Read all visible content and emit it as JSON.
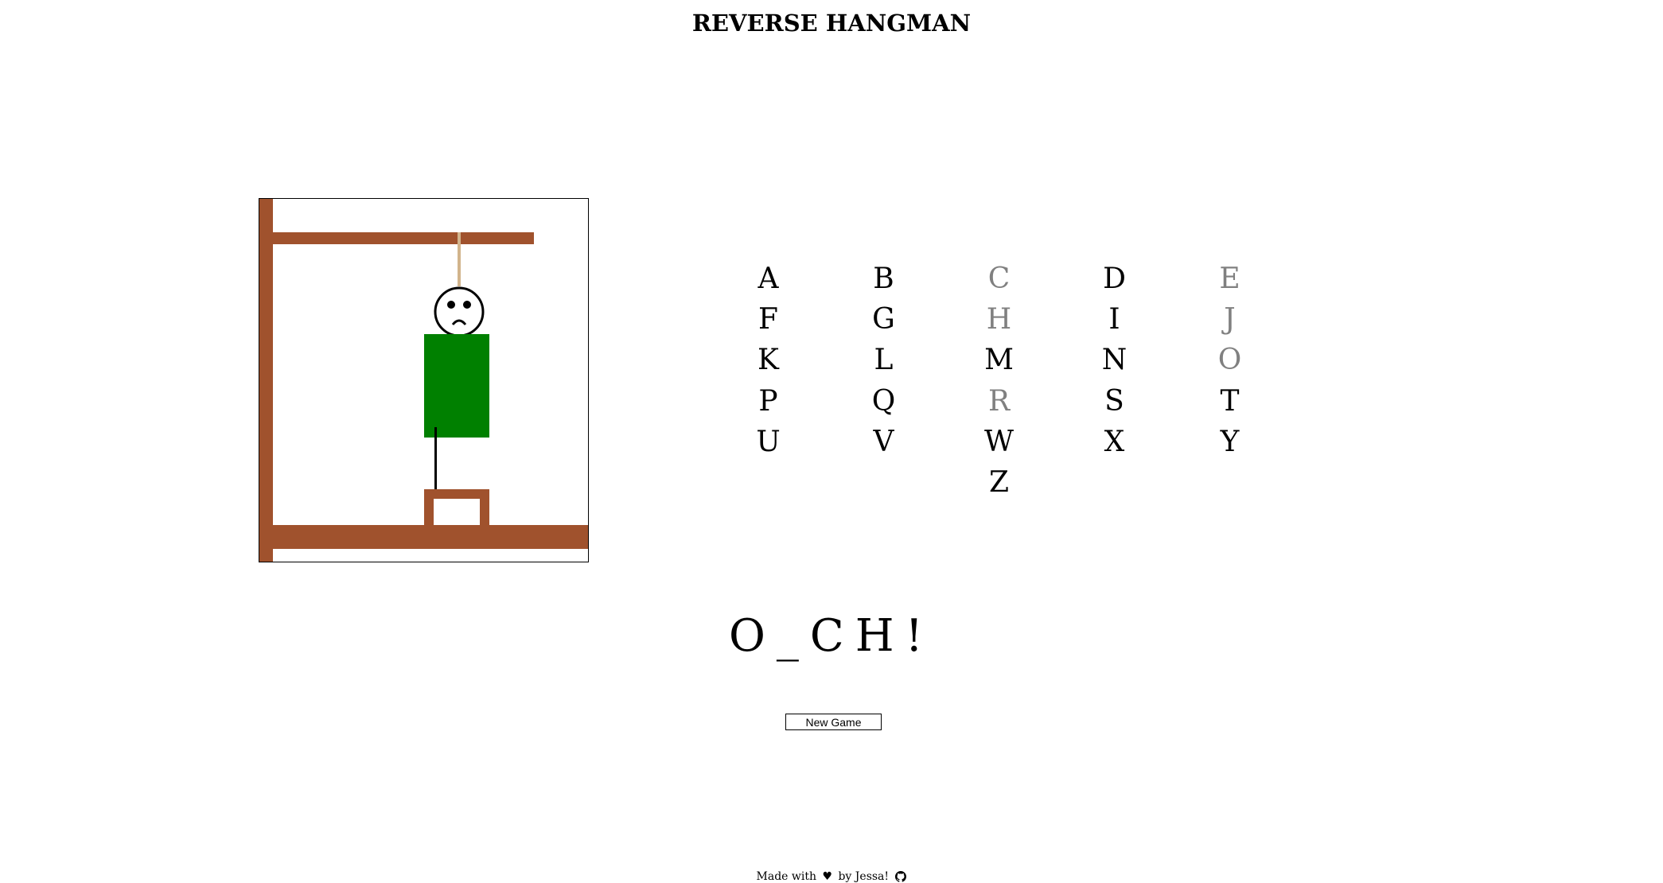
{
  "header": {
    "title": "REVERSE HANGMAN"
  },
  "gallows": {
    "wood_color": "#a0522d",
    "rope_color": "#d2b48c",
    "shirt_color": "#008000",
    "face_icon": "sad-face-icon"
  },
  "alphabet": {
    "letters": [
      {
        "char": "A",
        "used": false
      },
      {
        "char": "B",
        "used": false
      },
      {
        "char": "C",
        "used": true
      },
      {
        "char": "D",
        "used": false
      },
      {
        "char": "E",
        "used": true
      },
      {
        "char": "F",
        "used": false
      },
      {
        "char": "G",
        "used": false
      },
      {
        "char": "H",
        "used": true
      },
      {
        "char": "I",
        "used": false
      },
      {
        "char": "J",
        "used": true
      },
      {
        "char": "K",
        "used": false
      },
      {
        "char": "L",
        "used": false
      },
      {
        "char": "M",
        "used": false
      },
      {
        "char": "N",
        "used": false
      },
      {
        "char": "O",
        "used": true
      },
      {
        "char": "P",
        "used": false
      },
      {
        "char": "Q",
        "used": false
      },
      {
        "char": "R",
        "used": true
      },
      {
        "char": "S",
        "used": false
      },
      {
        "char": "T",
        "used": false
      },
      {
        "char": "U",
        "used": false
      },
      {
        "char": "V",
        "used": false
      },
      {
        "char": "W",
        "used": false
      },
      {
        "char": "X",
        "used": false
      },
      {
        "char": "Y",
        "used": false
      },
      {
        "char": "Z",
        "used": false
      }
    ],
    "used_color": "#808080"
  },
  "word": {
    "display": "O_CH!"
  },
  "controls": {
    "new_game_label": "New Game"
  },
  "footer": {
    "made_with": "Made with",
    "heart": "♥",
    "by": "by Jessa!",
    "github_icon": "github-icon"
  }
}
